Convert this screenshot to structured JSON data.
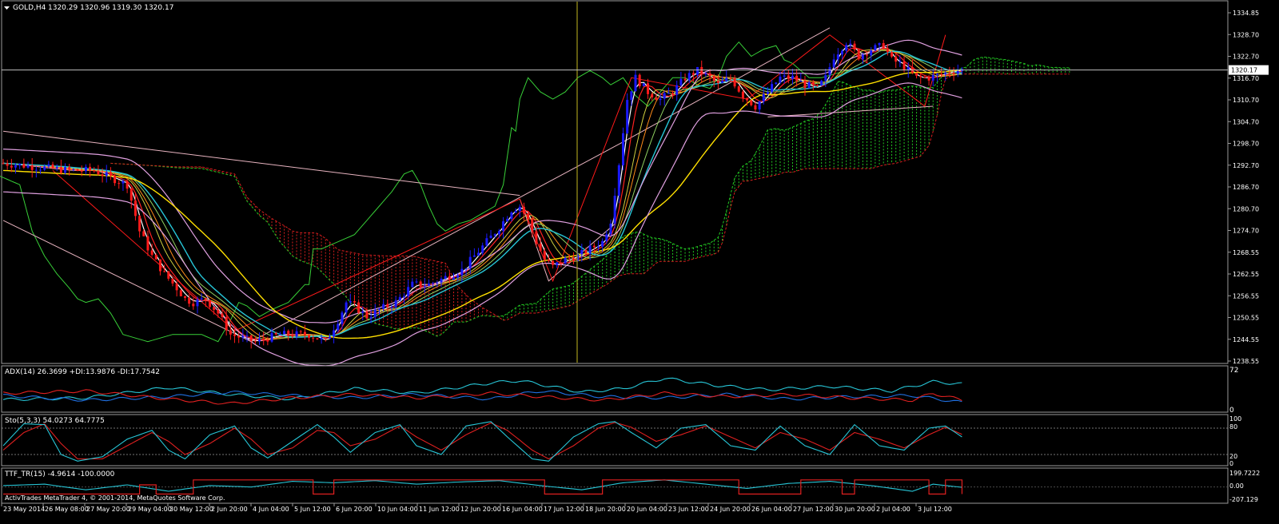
{
  "colors": {
    "background": "#000000",
    "panel_border": "#9a9a9a",
    "bull_candle": "#1a1aff",
    "bear_candle": "#ff1a1a",
    "bid_line": "#c0c0c0",
    "cursor_line": "#a39a1c",
    "kumo_bull": "#22c722",
    "kumo_bear": "#d61e1e",
    "chikou": "#38d038",
    "adx_main": "#27c5d6",
    "di_plus": "#1f6fe0",
    "di_minus": "#e02020",
    "stoch_main": "#27c5d6",
    "stoch_signal": "#e02020",
    "ttf_main": "#27c5d6",
    "ttf_signal": "#e02020"
  },
  "main_header": {
    "menu_icon": "triangle-down-icon",
    "symbol": "GOLD,H4",
    "ohlc": "1320.29 1320.96 1319.30 1320.17"
  },
  "price_axis": {
    "labels": [
      "1334.85",
      "1328.70",
      "1322.70",
      "1316.70",
      "1310.70",
      "1304.70",
      "1298.70",
      "1292.70",
      "1286.70",
      "1280.70",
      "1274.70",
      "1268.55",
      "1262.55",
      "1256.55",
      "1250.55",
      "1244.55",
      "1238.55"
    ],
    "current_price": "1320.17"
  },
  "indicators": {
    "adx": {
      "header": "ADX(14) 26.3699 +DI:13.9876 -DI:17.7542",
      "scale_labels": [
        "72",
        "0"
      ]
    },
    "stoch": {
      "header": "Sto(5,3,3) 54.0273 64.7775",
      "scale_labels": [
        "100",
        "80",
        "20",
        "0"
      ]
    },
    "ttf": {
      "header": "TTF_TR(15) -4.9614 -100.0000",
      "scale_labels": [
        "199.7222",
        "0.00",
        "-207.129"
      ]
    }
  },
  "time_axis": {
    "labels": [
      "23 May 2014",
      "26 May 08:00",
      "27 May 20:00",
      "29 May 04:00",
      "30 May 12:00",
      "2 Jun 20:00",
      "4 Jun 04:00",
      "5 Jun 12:00",
      "6 Jun 20:00",
      "10 Jun 04:00",
      "11 Jun 12:00",
      "12 Jun 20:00",
      "16 Jun 04:00",
      "17 Jun 12:00",
      "18 Jun 20:00",
      "20 Jun 04:00",
      "23 Jun 12:00",
      "24 Jun 20:00",
      "26 Jun 04:00",
      "27 Jun 12:00",
      "30 Jun 20:00",
      "2 Jul 04:00",
      "3 Jul 12:00"
    ]
  },
  "footer": {
    "copyright": "ActivTrades MetaTrader 4, © 2001-2014, MetaQuotes Software Corp."
  },
  "chart_data": {
    "type": "candlestick",
    "symbol": "GOLD",
    "timeframe": "H4",
    "ylim": [
      1238.55,
      1338
    ],
    "bid": 1320.17,
    "close_path": [
      [
        0,
        1294
      ],
      [
        8,
        1293
      ],
      [
        16,
        1292
      ],
      [
        22,
        1292
      ],
      [
        26,
        1290
      ],
      [
        30,
        1288
      ],
      [
        33,
        1275
      ],
      [
        36,
        1268
      ],
      [
        39,
        1263
      ],
      [
        42,
        1259
      ],
      [
        44,
        1256
      ],
      [
        46,
        1255
      ],
      [
        49,
        1256
      ],
      [
        52,
        1252
      ],
      [
        55,
        1246
      ],
      [
        58,
        1245
      ],
      [
        61,
        1244
      ],
      [
        64,
        1245
      ],
      [
        67,
        1246
      ],
      [
        70,
        1246
      ],
      [
        74,
        1246
      ],
      [
        78,
        1244
      ],
      [
        81,
        1250
      ],
      [
        83,
        1255
      ],
      [
        85,
        1254
      ],
      [
        88,
        1251
      ],
      [
        91,
        1253
      ],
      [
        95,
        1255
      ],
      [
        99,
        1260
      ],
      [
        103,
        1260
      ],
      [
        107,
        1262
      ],
      [
        111,
        1264
      ],
      [
        114,
        1268
      ],
      [
        117,
        1272
      ],
      [
        120,
        1276
      ],
      [
        123,
        1281
      ],
      [
        125,
        1282
      ],
      [
        127,
        1278
      ],
      [
        129,
        1272
      ],
      [
        131,
        1267
      ],
      [
        133,
        1265
      ],
      [
        136,
        1267
      ],
      [
        139,
        1268
      ],
      [
        142,
        1270
      ],
      [
        145,
        1272
      ],
      [
        147,
        1278
      ],
      [
        149,
        1294
      ],
      [
        151,
        1312
      ],
      [
        153,
        1318
      ],
      [
        156,
        1314
      ],
      [
        159,
        1312
      ],
      [
        162,
        1314
      ],
      [
        165,
        1318
      ],
      [
        168,
        1320
      ],
      [
        171,
        1318
      ],
      [
        173,
        1316
      ],
      [
        176,
        1318
      ],
      [
        179,
        1313
      ],
      [
        182,
        1310
      ],
      [
        185,
        1314
      ],
      [
        188,
        1318
      ],
      [
        191,
        1318
      ],
      [
        194,
        1316
      ],
      [
        197,
        1315
      ],
      [
        199,
        1318
      ],
      [
        201,
        1324
      ],
      [
        204,
        1328
      ],
      [
        207,
        1324
      ],
      [
        210,
        1326
      ],
      [
        213,
        1327
      ],
      [
        215,
        1323
      ],
      [
        217,
        1322
      ],
      [
        219,
        1320
      ],
      [
        221,
        1318
      ],
      [
        224,
        1318
      ],
      [
        227,
        1319
      ],
      [
        230,
        1320
      ],
      [
        232,
        1320.17
      ]
    ],
    "series": [
      {
        "values": [
          [
            0,
            19
          ],
          [
            20,
            22
          ],
          [
            40,
            40
          ],
          [
            55,
            28
          ],
          [
            70,
            20
          ],
          [
            85,
            38
          ],
          [
            100,
            30
          ],
          [
            118,
            48
          ],
          [
            125,
            52
          ],
          [
            140,
            32
          ],
          [
            150,
            38
          ],
          [
            160,
            56
          ],
          [
            172,
            44
          ],
          [
            185,
            36
          ],
          [
            200,
            42
          ],
          [
            215,
            34
          ],
          [
            225,
            50
          ],
          [
            232,
            46
          ]
        ]
      },
      {
        "values": [
          [
            0,
            26
          ],
          [
            20,
            18
          ],
          [
            40,
            24
          ],
          [
            55,
            32
          ],
          [
            70,
            26
          ],
          [
            85,
            22
          ],
          [
            100,
            28
          ],
          [
            118,
            20
          ],
          [
            130,
            34
          ],
          [
            145,
            24
          ],
          [
            160,
            22
          ],
          [
            175,
            28
          ],
          [
            190,
            20
          ],
          [
            205,
            24
          ],
          [
            220,
            26
          ],
          [
            232,
            14
          ]
        ]
      },
      {
        "values": [
          [
            0,
            30
          ],
          [
            20,
            34
          ],
          [
            40,
            20
          ],
          [
            55,
            12
          ],
          [
            70,
            22
          ],
          [
            85,
            28
          ],
          [
            100,
            22
          ],
          [
            118,
            30
          ],
          [
            130,
            24
          ],
          [
            145,
            18
          ],
          [
            160,
            30
          ],
          [
            175,
            24
          ],
          [
            190,
            28
          ],
          [
            205,
            22
          ],
          [
            220,
            18
          ],
          [
            225,
            30
          ],
          [
            232,
            18
          ]
        ]
      }
    ],
    "stochastic": {
      "levels": [
        80,
        20
      ],
      "main": [
        [
          0,
          40
        ],
        [
          5,
          90
        ],
        [
          10,
          88
        ],
        [
          14,
          20
        ],
        [
          18,
          5
        ],
        [
          24,
          15
        ],
        [
          30,
          55
        ],
        [
          36,
          75
        ],
        [
          40,
          30
        ],
        [
          44,
          10
        ],
        [
          50,
          65
        ],
        [
          56,
          85
        ],
        [
          60,
          35
        ],
        [
          64,
          12
        ],
        [
          70,
          50
        ],
        [
          76,
          88
        ],
        [
          80,
          60
        ],
        [
          84,
          25
        ],
        [
          90,
          70
        ],
        [
          96,
          88
        ],
        [
          100,
          40
        ],
        [
          106,
          20
        ],
        [
          112,
          85
        ],
        [
          118,
          95
        ],
        [
          122,
          60
        ],
        [
          128,
          10
        ],
        [
          132,
          5
        ],
        [
          138,
          60
        ],
        [
          144,
          90
        ],
        [
          148,
          95
        ],
        [
          152,
          70
        ],
        [
          158,
          35
        ],
        [
          164,
          80
        ],
        [
          170,
          88
        ],
        [
          176,
          40
        ],
        [
          182,
          30
        ],
        [
          188,
          85
        ],
        [
          194,
          40
        ],
        [
          200,
          20
        ],
        [
          206,
          88
        ],
        [
          212,
          40
        ],
        [
          218,
          30
        ],
        [
          224,
          80
        ],
        [
          228,
          85
        ],
        [
          232,
          60
        ]
      ],
      "signal": [
        [
          0,
          30
        ],
        [
          5,
          70
        ],
        [
          10,
          90
        ],
        [
          14,
          45
        ],
        [
          18,
          10
        ],
        [
          24,
          10
        ],
        [
          30,
          40
        ],
        [
          36,
          70
        ],
        [
          40,
          50
        ],
        [
          44,
          20
        ],
        [
          50,
          45
        ],
        [
          56,
          80
        ],
        [
          60,
          55
        ],
        [
          64,
          20
        ],
        [
          70,
          35
        ],
        [
          76,
          75
        ],
        [
          80,
          70
        ],
        [
          84,
          40
        ],
        [
          90,
          55
        ],
        [
          96,
          85
        ],
        [
          100,
          60
        ],
        [
          106,
          30
        ],
        [
          112,
          65
        ],
        [
          118,
          92
        ],
        [
          122,
          75
        ],
        [
          128,
          30
        ],
        [
          132,
          10
        ],
        [
          138,
          40
        ],
        [
          144,
          80
        ],
        [
          148,
          93
        ],
        [
          152,
          82
        ],
        [
          158,
          50
        ],
        [
          164,
          65
        ],
        [
          170,
          85
        ],
        [
          176,
          60
        ],
        [
          182,
          35
        ],
        [
          188,
          70
        ],
        [
          194,
          55
        ],
        [
          200,
          30
        ],
        [
          206,
          70
        ],
        [
          212,
          55
        ],
        [
          218,
          35
        ],
        [
          224,
          65
        ],
        [
          228,
          82
        ],
        [
          232,
          66
        ]
      ]
    },
    "ttf": {
      "ylim": [
        -207.129,
        199.7222
      ],
      "main": [
        [
          0,
          20
        ],
        [
          10,
          40
        ],
        [
          20,
          -40
        ],
        [
          30,
          30
        ],
        [
          40,
          -60
        ],
        [
          50,
          20
        ],
        [
          60,
          0
        ],
        [
          70,
          80
        ],
        [
          80,
          60
        ],
        [
          90,
          90
        ],
        [
          100,
          40
        ],
        [
          110,
          70
        ],
        [
          120,
          90
        ],
        [
          130,
          20
        ],
        [
          140,
          -40
        ],
        [
          150,
          60
        ],
        [
          160,
          100
        ],
        [
          170,
          40
        ],
        [
          180,
          -20
        ],
        [
          190,
          50
        ],
        [
          200,
          80
        ],
        [
          210,
          20
        ],
        [
          220,
          -60
        ],
        [
          225,
          40
        ],
        [
          232,
          -4.96
        ]
      ],
      "signal": [
        [
          0,
          -100
        ],
        [
          30,
          -100
        ],
        [
          33,
          30
        ],
        [
          37,
          -100
        ],
        [
          42,
          -100
        ],
        [
          46,
          100
        ],
        [
          70,
          100
        ],
        [
          75,
          -100
        ],
        [
          80,
          100
        ],
        [
          128,
          100
        ],
        [
          131,
          -100
        ],
        [
          140,
          -100
        ],
        [
          145,
          100
        ],
        [
          175,
          100
        ],
        [
          178,
          -100
        ],
        [
          190,
          -100
        ],
        [
          193,
          100
        ],
        [
          200,
          100
        ],
        [
          203,
          -100
        ],
        [
          206,
          100
        ],
        [
          222,
          100
        ],
        [
          224,
          -100
        ],
        [
          228,
          100
        ],
        [
          232,
          -100
        ]
      ]
    }
  }
}
